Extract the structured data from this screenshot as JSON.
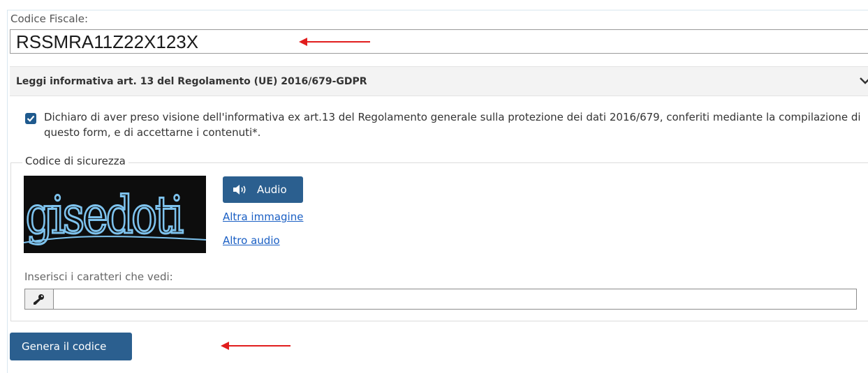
{
  "codice_fiscale": {
    "label": "Codice Fiscale:",
    "value": "RSSMRA11Z22X123X"
  },
  "gdpr_accordion": {
    "title": "Leggi informativa art. 13 del Regolamento (UE) 2016/679-GDPR",
    "expanded": false
  },
  "consent": {
    "checked": true,
    "text": "Dichiaro di aver preso visione dell'informativa ex art.13 del Regolamento generale sulla protezione dei dati 2016/679, conferiti mediante la compilazione di questo form, e di accettarne i contenuti*."
  },
  "security": {
    "legend": "Codice di sicurezza",
    "captcha_text": "gisedoti",
    "audio_button": "Audio",
    "other_image_link": "Altra immagine",
    "other_audio_link": "Altro audio",
    "input_label": "Inserisci i caratteri che vedi:",
    "input_value": ""
  },
  "submit_button": "Genera il codice",
  "colors": {
    "button_bg": "#2b5f8f",
    "link": "#1a5fc4",
    "annotation_arrow": "#e11d1d",
    "captcha_text": "#7ec3ee",
    "captcha_bg": "#0d0d0d"
  },
  "icons": {
    "accordion": "chevron-down-icon",
    "audio": "speaker-icon",
    "input_addon": "key-icon",
    "checkbox": "checkmark-icon"
  }
}
